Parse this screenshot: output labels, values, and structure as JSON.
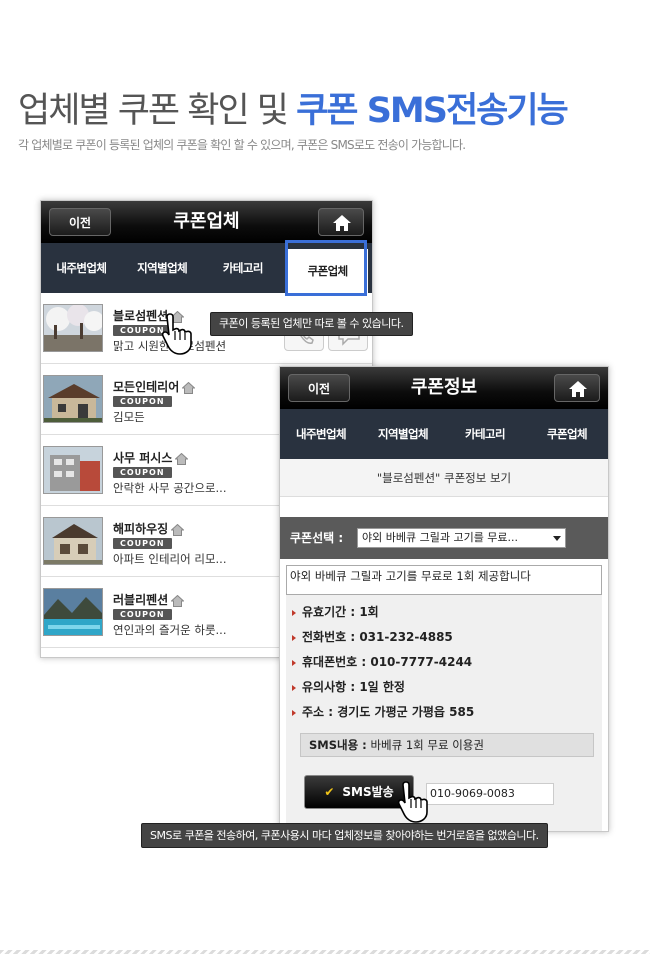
{
  "header": {
    "title_part1": "업체별 쿠폰 확인 및 ",
    "title_part2": "쿠폰 SMS전송기능",
    "subtitle": "각 업체별로 쿠폰이 등록된 업체의 쿠폰을 확인 할 수 있으며, 쿠폰은 SMS로도 전송이 가능합니다."
  },
  "screen1": {
    "back": "이전",
    "title": "쿠폰업체",
    "tabs": [
      {
        "label": "내주변업체"
      },
      {
        "label": "지역별업체"
      },
      {
        "label": "카테고리"
      },
      {
        "label": "쿠폰업체",
        "active": true
      }
    ],
    "items": [
      {
        "name": "블로섬펜션",
        "badge": "COUPON",
        "desc": "맑고 시원한 블로섬펜션"
      },
      {
        "name": "모든인테리어",
        "badge": "COUPON",
        "desc": "김모든"
      },
      {
        "name": "사무 퍼시스",
        "badge": "COUPON",
        "desc": "안락한 사무 공간으로..."
      },
      {
        "name": "해피하우징",
        "badge": "COUPON",
        "desc": "아파트 인테리어 리모..."
      },
      {
        "name": "러블리펜션",
        "badge": "COUPON",
        "desc": "연인과의 즐거운 하룻..."
      }
    ],
    "tooltip": "쿠폰이 등록된 업체만 따로 볼 수 있습니다."
  },
  "screen2": {
    "back": "이전",
    "title": "쿠폰정보",
    "tabs": [
      {
        "label": "내주변업체"
      },
      {
        "label": "지역별업체"
      },
      {
        "label": "카테고리"
      },
      {
        "label": "쿠폰업체"
      }
    ],
    "subheader": "\"블로섬펜션\" 쿠폰정보 보기",
    "select_label": "쿠폰선택 :",
    "select_value": "야외 바베큐 그릴과 고기를 무료...",
    "coupon_text": "야외 바베큐 그릴과 고기를 무료로 1회 제공합니다",
    "info": [
      "유효기간 : 1회",
      "전화번호 : 031-232-4885",
      "휴대폰번호 : 010-7777-4244",
      "유의사항 : 1일 한정",
      "주소 : 경기도 가평군 가평읍 585"
    ],
    "sms_label": "SMS내용 :",
    "sms_value": "바베큐 1회 무료 이용권",
    "sms_button": "SMS발송",
    "sms_phone": "010-9069-0083",
    "tooltip": "SMS로 쿠폰을 전송하여, 쿠폰사용시 마다 업체정보를 찾아야하는 번거로움을 없앴습니다."
  },
  "colors": {
    "accent": "#3a6fd8",
    "tab_bar": "#29323f",
    "info_bullet": "#c0392b"
  }
}
